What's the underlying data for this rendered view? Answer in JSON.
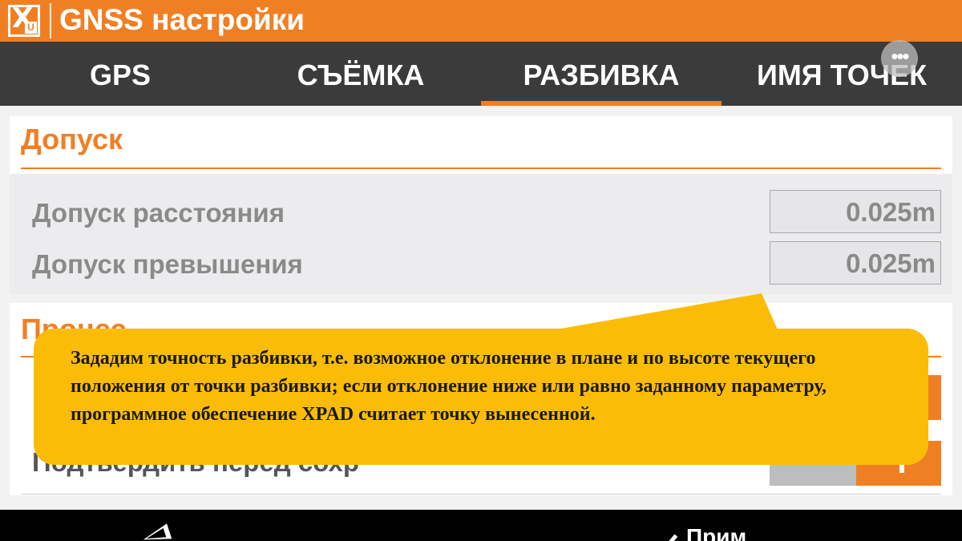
{
  "app": {
    "title": "GNSS настройки",
    "logo_letter": "X",
    "logo_sub": "U"
  },
  "tabs": [
    {
      "label": "GPS",
      "active": false
    },
    {
      "label": "СЪЁМКА",
      "active": false
    },
    {
      "label": "РАЗБИВКА",
      "active": true
    },
    {
      "label": "ИМЯ ТОЧЕК",
      "active": false
    }
  ],
  "overflow_icon": "more-vert-icon",
  "tolerance": {
    "title": "Допуск",
    "distance_label": "Допуск расстояния",
    "distance_value": "0.025m",
    "height_label": "Допуск превышения",
    "height_value": "0.025m"
  },
  "process": {
    "title": "Процес",
    "confirm_label": "Подтвердить перед сохр",
    "toggle_on": true
  },
  "callout": {
    "text": "Зададим точность разбивки, т.е. возможное отклонение в плане и по высоте текущего положения от точки разбивки; если отклонение ниже или равно заданному параметру, программное обеспечение XPAD считает точку вынесенной."
  },
  "bottom": {
    "apply_label": "Прим"
  },
  "colors": {
    "accent": "#f07f24",
    "tabbar": "#3b3b3b",
    "callout": "#fbbc07"
  }
}
